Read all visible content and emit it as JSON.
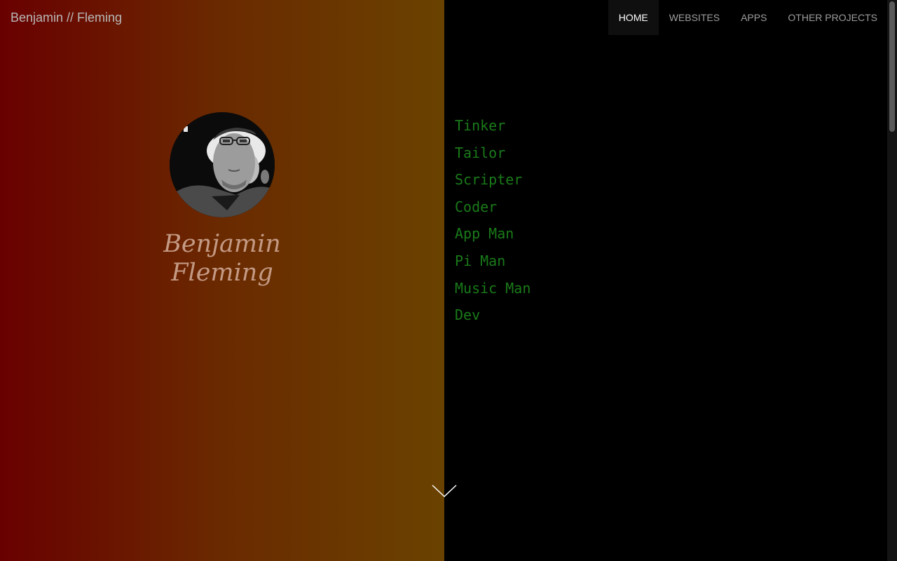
{
  "site": {
    "brand": "Benjamin // Fleming"
  },
  "nav": {
    "items": [
      {
        "label": "HOME",
        "active": true
      },
      {
        "label": "WEBSITES",
        "active": false
      },
      {
        "label": "APPS",
        "active": false
      },
      {
        "label": "OTHER PROJECTS",
        "active": false
      }
    ]
  },
  "hero": {
    "name_line1": "Benjamin",
    "name_line2": "Fleming",
    "roles": [
      "Tinker",
      "Tailor",
      "Scripter",
      "Coder",
      "App Man",
      "Pi Man",
      "Music Man",
      "Dev"
    ]
  },
  "icons": {
    "scroll": "chevron-down-icon"
  },
  "colors": {
    "gradient_start": "#690000",
    "gradient_end": "#6a4200",
    "role_text": "#1a7a1a",
    "name_text": "#c49a85"
  }
}
